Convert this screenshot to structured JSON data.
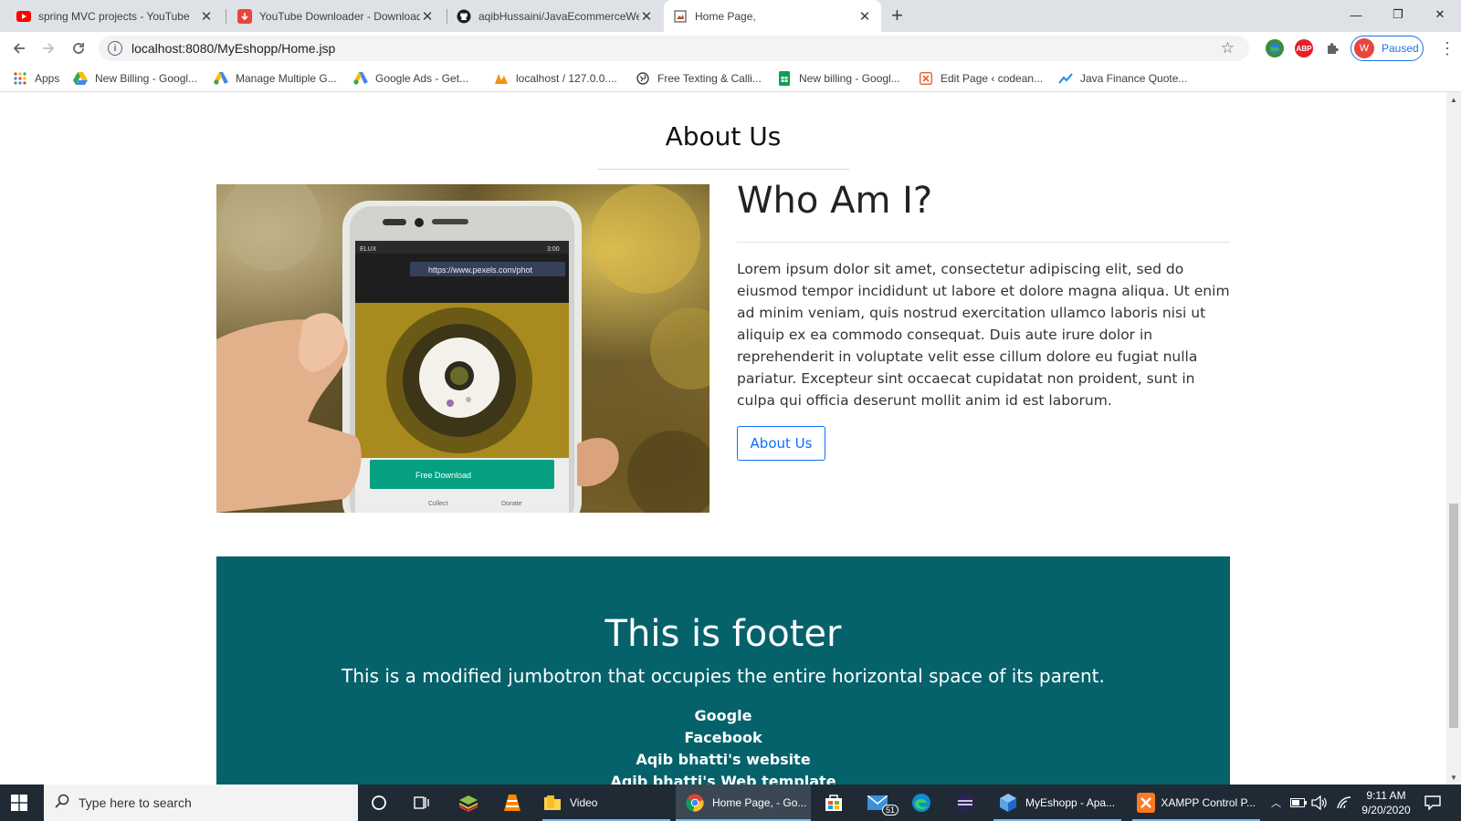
{
  "browser": {
    "tabs": [
      {
        "title": "spring MVC projects - YouTube",
        "icon": "youtube-icon",
        "color": "#ff0000",
        "active": false
      },
      {
        "title": "YouTube Downloader - Download",
        "icon": "download-icon",
        "color": "#e8453c",
        "active": false
      },
      {
        "title": "aqibHussaini/JavaEcommerceWe",
        "icon": "github-icon",
        "color": "#000000",
        "active": false
      },
      {
        "title": "Home Page,",
        "icon": "page-icon",
        "color": "#5f6368",
        "active": true
      }
    ],
    "new_tab": "+",
    "window_controls": {
      "minimize": "—",
      "restore": "❐",
      "close": "✕"
    },
    "url": "localhost:8080/MyEshopp/Home.jsp",
    "profile": {
      "initial": "W",
      "status": "Paused"
    },
    "extensions": [
      {
        "name": "globe-extension-icon",
        "color": "#3a8d3a",
        "label": ""
      },
      {
        "name": "adblock-icon",
        "color": "#e8202a",
        "label": "ABP"
      },
      {
        "name": "puzzle-icon",
        "color": "#5f6368",
        "label": ""
      }
    ],
    "bookmarks": [
      {
        "label": "Apps",
        "icon": "apps-grid-icon"
      },
      {
        "label": "New Billing - Googl...",
        "icon": "google-drive-icon"
      },
      {
        "label": "Manage Multiple G...",
        "icon": "google-ads-icon"
      },
      {
        "label": "Google Ads - Get...",
        "icon": "google-ads-icon"
      },
      {
        "label": "localhost / 127.0.0....",
        "icon": "phpmyadmin-icon"
      },
      {
        "label": "Free Texting & Calli...",
        "icon": "globe-icon"
      },
      {
        "label": "New billing - Googl...",
        "icon": "google-sheets-icon"
      },
      {
        "label": "Edit Page ‹ codean...",
        "icon": "codeanywhere-icon"
      },
      {
        "label": "Java Finance Quote...",
        "icon": "chart-trend-icon"
      }
    ]
  },
  "page": {
    "section_title": "About Us",
    "heading": "Who Am I?",
    "body": "Lorem ipsum dolor sit amet, consectetur adipiscing elit, sed do eiusmod tempor incididunt ut labore et dolore magna aliqua. Ut enim ad minim veniam, quis nostrud exercitation ullamco laboris nisi ut aliquip ex ea commodo consequat. Duis aute irure dolor in reprehenderit in voluptate velit esse cillum dolore eu fugiat nulla pariatur. Excepteur sint occaecat cupidatat non proident, sunt in culpa qui officia deserunt mollit anim id est laborum.",
    "button_label": "About Us",
    "photo": {
      "status_bar": "ELUX",
      "status_right": "3:00",
      "url": "https://www.pexels.com/phot",
      "download_label": "Free Download",
      "collect_label": "Collect",
      "donate_label": "Donate"
    },
    "footer": {
      "title": "This is footer",
      "lead": "This is a modified jumbotron that occupies the entire horizontal space of its parent.",
      "links": [
        "Google",
        "Facebook",
        "Aqib bhatti's website",
        "Aqib bhatti's Web template"
      ]
    }
  },
  "taskbar": {
    "search_placeholder": "Type here to search",
    "apps": [
      {
        "label": "Video",
        "icon": "folder-icon"
      },
      {
        "label": "Home Page, - Go...",
        "icon": "chrome-icon"
      },
      {
        "label": "MyEshopp - Apa...",
        "icon": "netbeans-icon"
      },
      {
        "label": "XAMPP Control P...",
        "icon": "xampp-icon"
      }
    ],
    "mail_badge": "51",
    "time": "9:11 AM",
    "date": "9/20/2020"
  },
  "colors": {
    "footer_bg": "#05626a",
    "button_accent": "#0d6efd",
    "taskbar_bg": "#1f2a35"
  }
}
